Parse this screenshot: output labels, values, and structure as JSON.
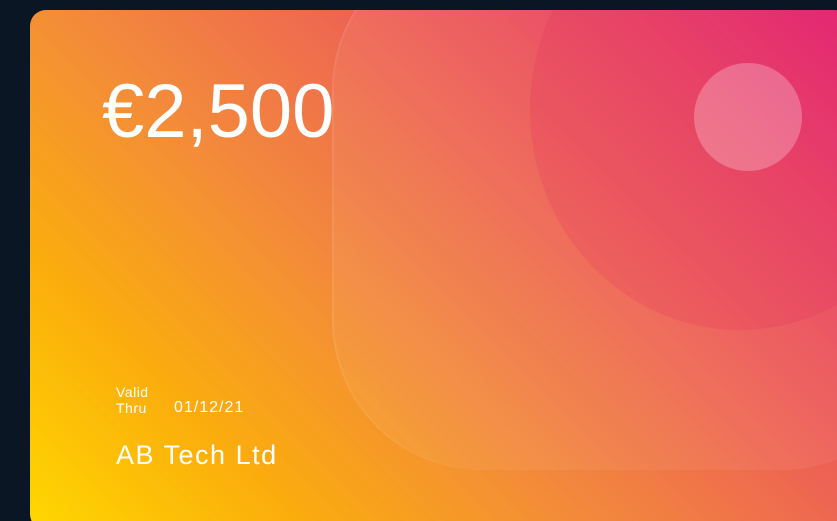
{
  "card": {
    "amount": "€2,500",
    "valid_label": "Valid Thru",
    "valid_date": "01/12/21",
    "company": "AB Tech Ltd"
  },
  "colors": {
    "background": "#0b1624",
    "gradient_start": "#ffd800",
    "gradient_mid": "#f38a3b",
    "gradient_end": "#e31a70",
    "text": "#ffffff"
  }
}
